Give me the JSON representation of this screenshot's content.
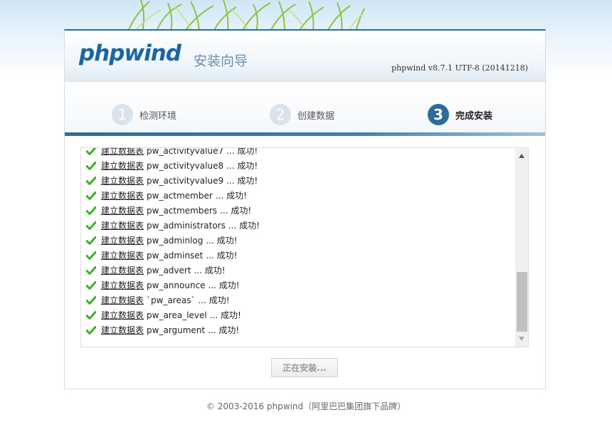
{
  "header": {
    "logo": "phpwind",
    "subtitle": "安装向导",
    "version": "phpwind v8.7.1 UTF-8 (20141218)"
  },
  "steps": [
    {
      "num": "1",
      "label": "检测环境",
      "active": false
    },
    {
      "num": "2",
      "label": "创建数据",
      "active": false
    },
    {
      "num": "3",
      "label": "完成安装",
      "active": true
    }
  ],
  "log": {
    "prefix": "建立数据表",
    "items": [
      {
        "name": "pw_activityvalue7",
        "status": "... 成功!"
      },
      {
        "name": "pw_activityvalue8",
        "status": "... 成功!"
      },
      {
        "name": "pw_activityvalue9",
        "status": "... 成功!"
      },
      {
        "name": "pw_actmember",
        "status": "... 成功!"
      },
      {
        "name": "pw_actmembers",
        "status": "... 成功!"
      },
      {
        "name": "pw_administrators",
        "status": "... 成功!"
      },
      {
        "name": "pw_adminlog",
        "status": "... 成功!"
      },
      {
        "name": "pw_adminset",
        "status": "... 成功!"
      },
      {
        "name": "pw_advert",
        "status": "... 成功!"
      },
      {
        "name": "pw_announce",
        "status": "... 成功!"
      },
      {
        "name": "`pw_areas`",
        "status": "... 成功!"
      },
      {
        "name": "pw_area_level",
        "status": "... 成功!"
      },
      {
        "name": "pw_argument",
        "status": "... 成功!"
      }
    ]
  },
  "button": {
    "label": "正在安装..."
  },
  "footer": {
    "text": "© 2003-2016 phpwind（阿里巴巴集团旗下品牌）"
  },
  "colors": {
    "brand": "#1a65a5",
    "active_step": "#2f6b98",
    "check": "#3fae2a"
  }
}
